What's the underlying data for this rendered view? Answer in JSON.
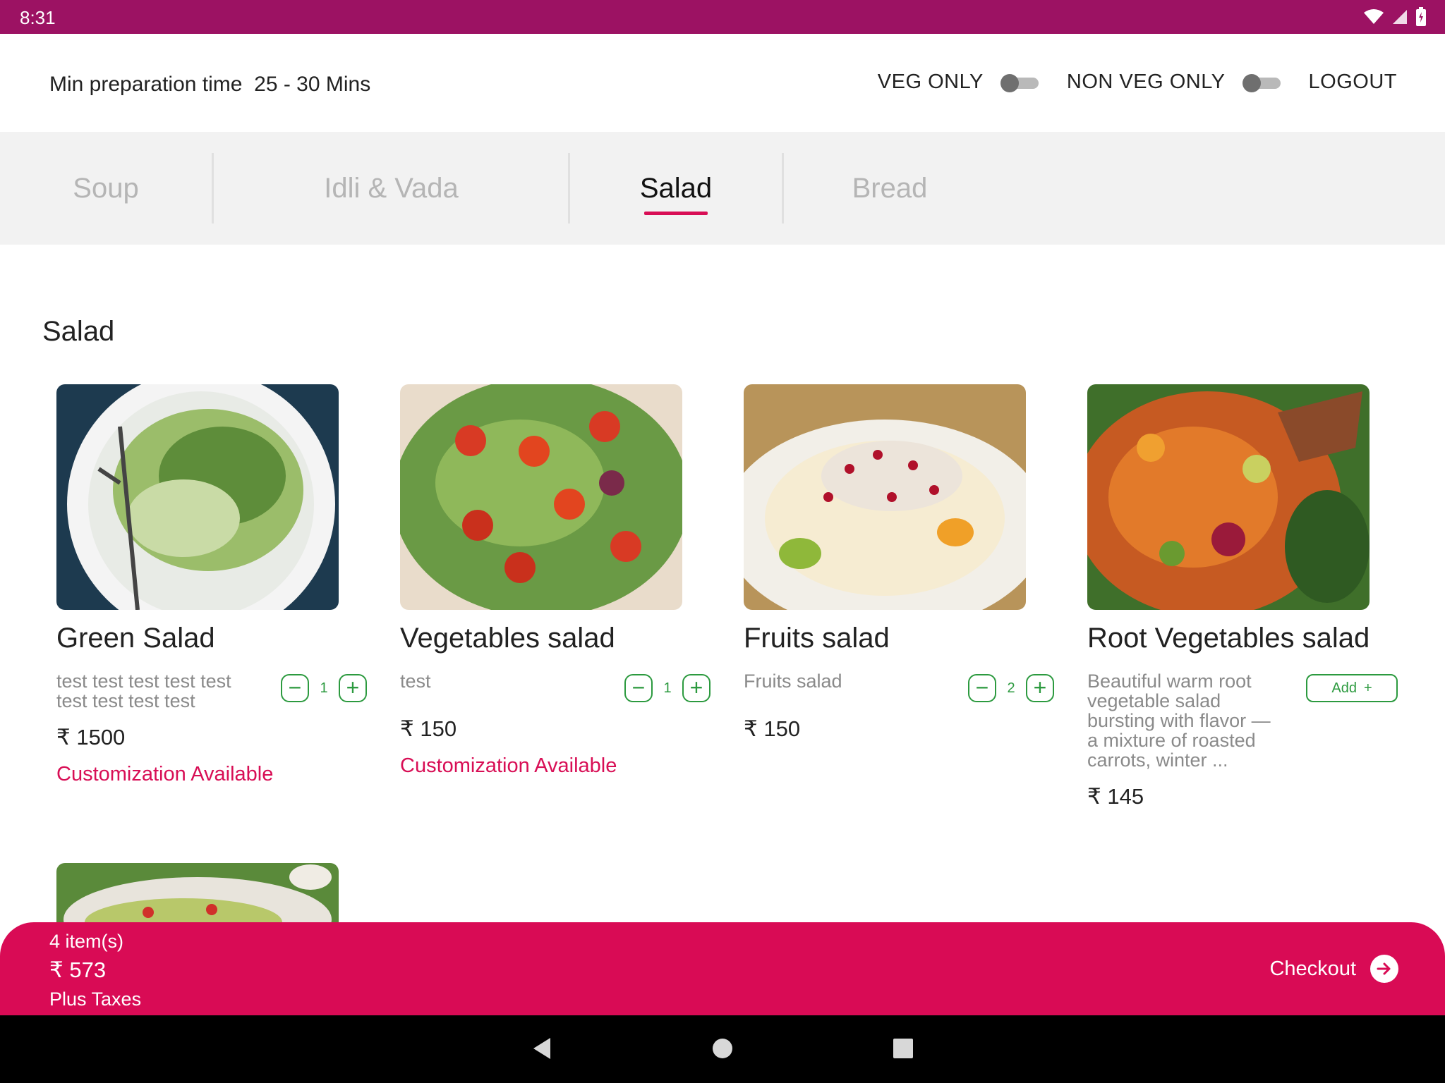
{
  "status_bar": {
    "time": "8:31"
  },
  "header": {
    "prep_label": "Min preparation time",
    "prep_value": "25 - 30 Mins",
    "veg_only_label": "VEG ONLY",
    "non_veg_only_label": "NON VEG ONLY",
    "logout_label": "LOGOUT"
  },
  "tabs": [
    {
      "label": "Soup",
      "active": false
    },
    {
      "label": "Idli & Vada",
      "active": false
    },
    {
      "label": "Salad",
      "active": true
    },
    {
      "label": "Bread",
      "active": false
    }
  ],
  "section_title": "Salad",
  "items": [
    {
      "name": "Green Salad",
      "description": "test test test test test test test test test",
      "price": "₹ 1500",
      "quantity": "1",
      "customization": "Customization Available",
      "image": "green-salad-photo"
    },
    {
      "name": "Vegetables salad",
      "description": "test",
      "price": "₹ 150",
      "quantity": "1",
      "customization": "Customization Available",
      "image": "vegetables-salad-photo"
    },
    {
      "name": "Fruits salad",
      "description": "Fruits salad",
      "price": "₹ 150",
      "quantity": "2",
      "image": "fruits-salad-photo"
    },
    {
      "name": "Root Vegetables salad",
      "description": "Beautiful warm root vegetable salad bursting with flavor — a mixture of roasted carrots, winter ...",
      "price": "₹ 145",
      "add_label": "Add",
      "image": "root-vegetables-salad-photo"
    }
  ],
  "cart": {
    "count": "4 item(s)",
    "total": "₹ 573",
    "taxes": "Plus Taxes",
    "checkout_label": "Checkout"
  },
  "colors": {
    "status_bar": "#9c1263",
    "accent": "#d80e55",
    "stepper_green": "#2c9a3f",
    "tabs_bg": "#f2f2f2"
  }
}
